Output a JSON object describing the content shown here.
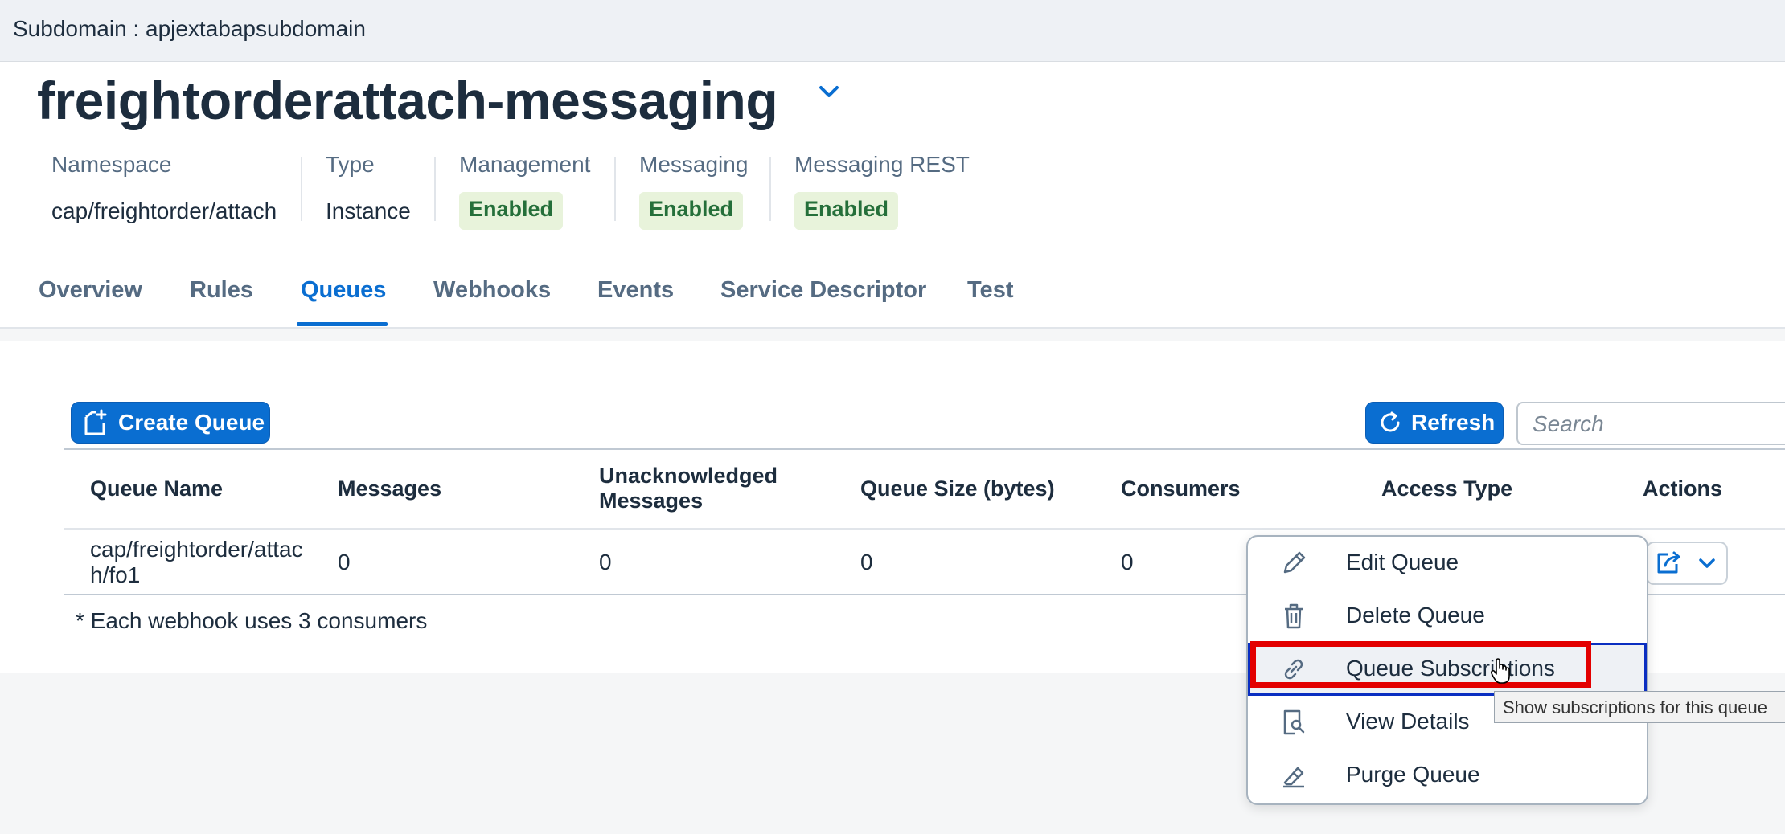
{
  "topbar": {
    "subdomain": "Subdomain : apjextabapsubdomain"
  },
  "header": {
    "title": "freightorderattach-messaging",
    "attributes": [
      {
        "label": "Namespace",
        "value": "cap/freightorder/attach"
      },
      {
        "label": "Type",
        "value": "Instance"
      },
      {
        "label": "Management",
        "value": "Enabled"
      },
      {
        "label": "Messaging",
        "value": "Enabled"
      },
      {
        "label": "Messaging REST",
        "value": "Enabled"
      }
    ],
    "status_color": "#e8f3db"
  },
  "tabs": [
    "Overview",
    "Rules",
    "Queues",
    "Webhooks",
    "Events",
    "Service Descriptor",
    "Test"
  ],
  "active_tab": "Queues",
  "toolbar": {
    "create_label": "Create Queue",
    "refresh_label": "Refresh",
    "search_placeholder": "Search"
  },
  "table": {
    "columns": {
      "queue_name": "Queue Name",
      "messages": "Messages",
      "unack_line1": "Unacknowledged",
      "unack_line2": "Messages",
      "queue_size": "Queue Size (bytes)",
      "consumers": "Consumers",
      "access_type": "Access Type",
      "actions": "Actions"
    },
    "rows": [
      {
        "queue_name_line1": "cap/freightorder/attac",
        "queue_name_line2": "h/fo1",
        "messages": "0",
        "unacknowledged": "0",
        "queue_size": "0",
        "consumers": "0"
      }
    ],
    "footnote": "* Each webhook uses 3 consumers"
  },
  "menu": {
    "items": [
      {
        "label": "Edit Queue",
        "icon": "pencil-icon"
      },
      {
        "label": "Delete Queue",
        "icon": "trash-icon"
      },
      {
        "label": "Queue Subscriptions",
        "icon": "link-icon"
      },
      {
        "label": "View Details",
        "icon": "document-search-icon"
      },
      {
        "label": "Purge Queue",
        "icon": "eraser-icon"
      }
    ],
    "focused": "Queue Subscriptions"
  },
  "tooltip": "Show subscriptions for this queue",
  "colors": {
    "accent": "#0a6ed1",
    "highlight": "#e30000"
  }
}
